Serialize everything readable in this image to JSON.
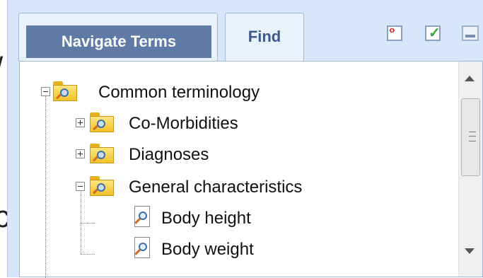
{
  "background": {
    "glyph_top": "/",
    "glyph_bottom": "c"
  },
  "tabs": [
    {
      "label": "Navigate Terms",
      "active": true
    },
    {
      "label": "Find",
      "active": false
    }
  ],
  "toolbar": {
    "icons": [
      "expand-collapse-icon",
      "check-icon",
      "window-icon"
    ]
  },
  "tree": {
    "root": {
      "label": "Common terminology",
      "expanded": true
    },
    "children": [
      {
        "label": "Co-Morbidities",
        "expanded": false
      },
      {
        "label": "Diagnoses",
        "expanded": false
      },
      {
        "label": "General characteristics",
        "expanded": true,
        "children": [
          {
            "label": "Body height"
          },
          {
            "label": "Body weight"
          }
        ]
      }
    ]
  },
  "colors": {
    "active_tab": "#607aa6",
    "panel": "#d7e6f8",
    "inactive_tab_text": "#3d5a88"
  }
}
